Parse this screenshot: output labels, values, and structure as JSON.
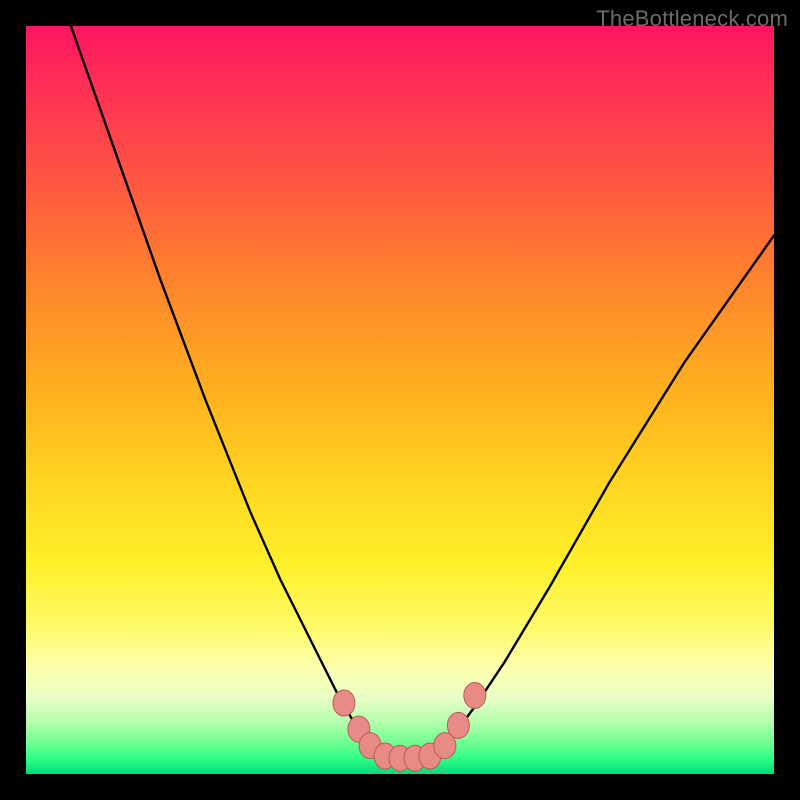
{
  "watermark": "TheBottleneck.com",
  "colors": {
    "frame": "#000000",
    "curve_stroke": "#000000",
    "marker_fill": "#e88b86",
    "marker_stroke": "#bb5a55",
    "gradient_stops": [
      "#ff1660",
      "#ff2f56",
      "#ff5a3f",
      "#ff8a2a",
      "#ffb41e",
      "#ffd822",
      "#fff02a",
      "#fffb67",
      "#fdffae",
      "#e8ffc7",
      "#b5ffae",
      "#6cff8f",
      "#2aff86",
      "#0bd77b"
    ]
  },
  "chart_data": {
    "type": "line",
    "title": "",
    "xlabel": "",
    "ylabel": "",
    "xlim": [
      0,
      100
    ],
    "ylim": [
      0,
      100
    ],
    "grid": false,
    "legend": false,
    "series": [
      {
        "name": "curve",
        "x": [
          6,
          12,
          18,
          24,
          30,
          34,
          38,
          42,
          45,
          47,
          49,
          51,
          53,
          55,
          57,
          60,
          64,
          70,
          78,
          88,
          100
        ],
        "y": [
          100,
          83,
          66,
          50,
          35,
          26,
          18,
          10,
          5,
          3,
          2,
          2,
          2,
          3,
          5,
          9,
          15,
          25,
          39,
          55,
          72
        ]
      }
    ],
    "markers": [
      {
        "x": 42.5,
        "y": 9.5
      },
      {
        "x": 44.5,
        "y": 6.0
      },
      {
        "x": 46.0,
        "y": 3.8
      },
      {
        "x": 48.0,
        "y": 2.4
      },
      {
        "x": 50.0,
        "y": 2.1
      },
      {
        "x": 52.0,
        "y": 2.1
      },
      {
        "x": 54.0,
        "y": 2.4
      },
      {
        "x": 56.0,
        "y": 3.8
      },
      {
        "x": 57.8,
        "y": 6.5
      },
      {
        "x": 60.0,
        "y": 10.5
      }
    ]
  }
}
